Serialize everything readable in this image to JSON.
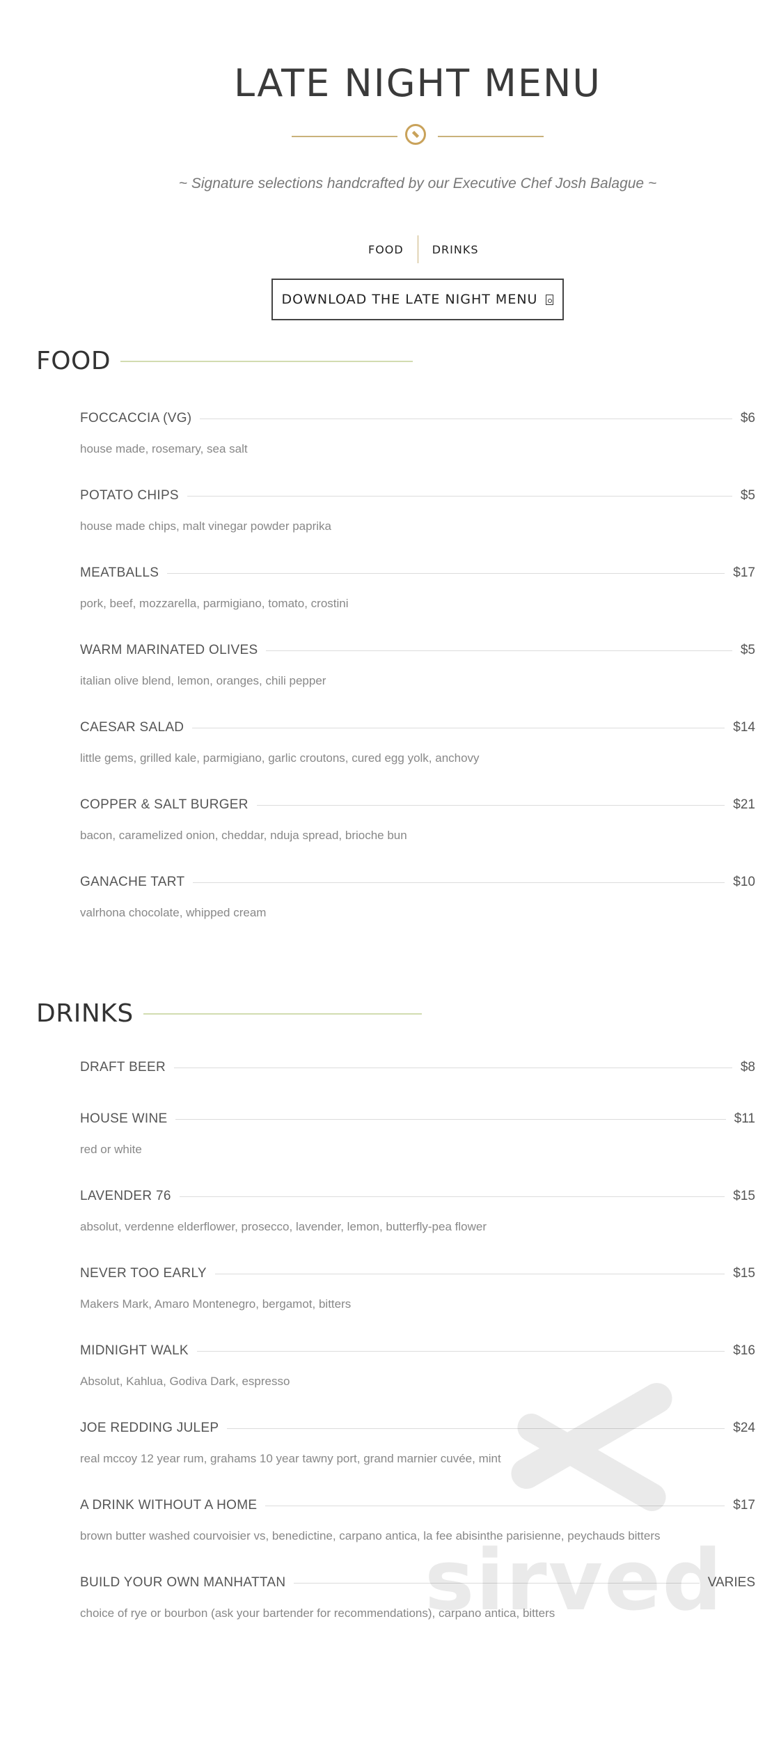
{
  "header": {
    "title": "LATE NIGHT MENU",
    "subtitle": "~ Signature selections handcrafted by our Executive Chef Josh Balague ~"
  },
  "tabs": [
    {
      "label": "FOOD"
    },
    {
      "label": "DRINKS"
    }
  ],
  "download": {
    "label": "DOWNLOAD THE LATE NIGHT MENU"
  },
  "food": {
    "heading": "FOOD",
    "items": [
      {
        "name": "FOCCACCIA (VG)",
        "price": "$6",
        "desc": "house made, rosemary, sea salt"
      },
      {
        "name": "POTATO CHIPS",
        "price": "$5",
        "desc": "house made chips, malt vinegar powder paprika"
      },
      {
        "name": "MEATBALLS",
        "price": "$17",
        "desc": "pork, beef, mozzarella, parmigiano, tomato, crostini"
      },
      {
        "name": "WARM MARINATED OLIVES",
        "price": "$5",
        "desc": "italian olive blend, lemon, oranges, chili pepper"
      },
      {
        "name": "CAESAR SALAD",
        "price": "$14",
        "desc": "little gems, grilled kale, parmigiano, garlic croutons, cured egg yolk, anchovy"
      },
      {
        "name": "COPPER & SALT BURGER",
        "price": "$21",
        "desc": "bacon, caramelized onion, cheddar, nduja spread, brioche bun"
      },
      {
        "name": "GANACHE TART",
        "price": "$10",
        "desc": "valrhona chocolate, whipped cream"
      }
    ]
  },
  "drinks": {
    "heading": "DRINKS",
    "items": [
      {
        "name": "DRAFT BEER",
        "price": "$8",
        "desc": ""
      },
      {
        "name": "HOUSE WINE",
        "price": "$11",
        "desc": "red or white"
      },
      {
        "name": "LAVENDER 76",
        "price": "$15",
        "desc": "absolut, verdenne elderflower, prosecco, lavender, lemon, butterfly-pea flower"
      },
      {
        "name": "NEVER TOO EARLY",
        "price": "$15",
        "desc": "Makers Mark, Amaro Montenegro, bergamot, bitters"
      },
      {
        "name": "MIDNIGHT WALK",
        "price": "$16",
        "desc": "Absolut, Kahlua, Godiva Dark, espresso"
      },
      {
        "name": "JOE REDDING JULEP",
        "price": "$24",
        "desc": "real mccoy 12 year rum, grahams 10 year tawny port, grand marnier cuvée, mint"
      },
      {
        "name": "A DRINK WITHOUT A HOME",
        "price": "$17",
        "desc": "brown butter washed courvoisier vs, benedictine, carpano antica, la fee abisinthe parisienne, peychauds bitters"
      },
      {
        "name": "BUILD YOUR OWN MANHATTAN",
        "price": "VARIES",
        "desc": "choice of rye or bourbon (ask your bartender for recommendations), carpano antica, bitters"
      }
    ]
  },
  "watermark": {
    "text": "sirved",
    "icon": "fork-knife-icon"
  }
}
